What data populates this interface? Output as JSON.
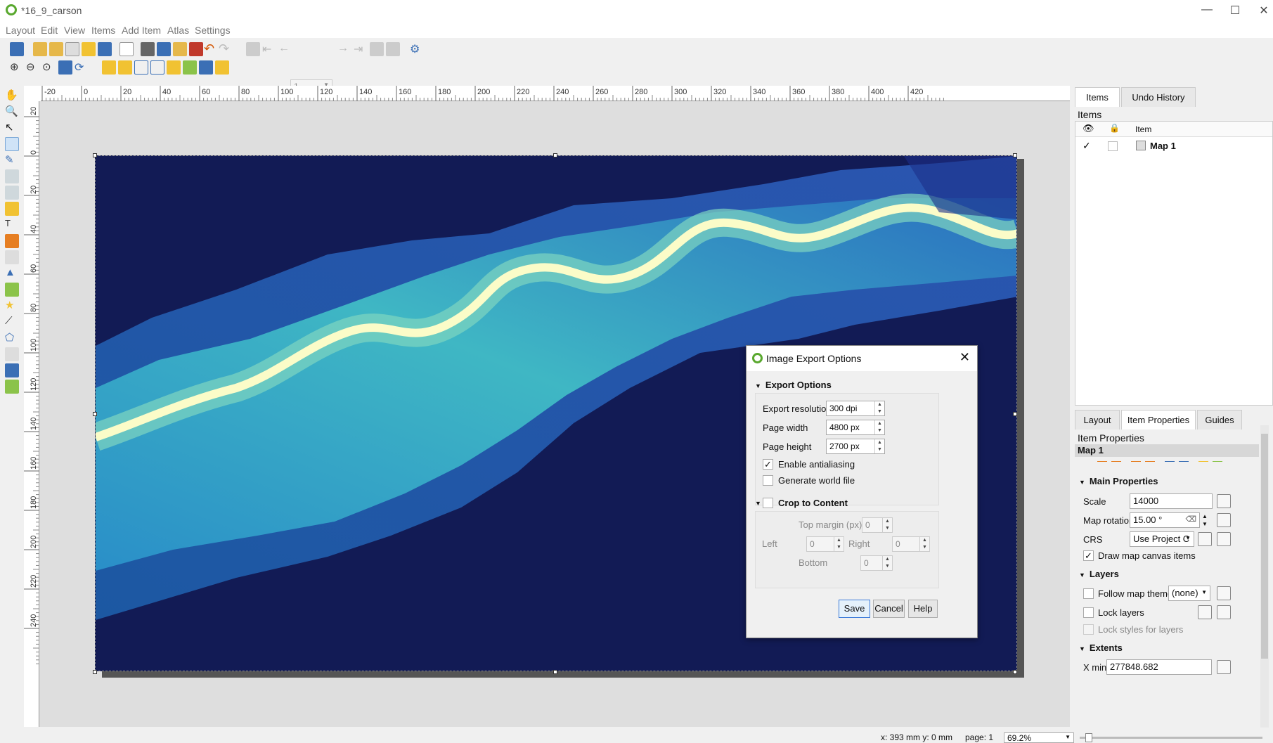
{
  "window": {
    "title": "*16_9_carson",
    "minimize": "—",
    "maximize": "☐",
    "close": "✕"
  },
  "menu": [
    "Layout",
    "Edit",
    "View",
    "Items",
    "Add Item",
    "Atlas",
    "Settings"
  ],
  "toolbar": {
    "atlas_page": "1"
  },
  "ruler": {
    "h_labels": [
      "-20",
      "0",
      "20",
      "40",
      "60",
      "80",
      "100",
      "120",
      "140",
      "160",
      "180",
      "200",
      "220",
      "240",
      "260",
      "280",
      "300",
      "320",
      "340",
      "360",
      "380",
      "400",
      "420"
    ],
    "v_labels": [
      "20",
      "0",
      "20",
      "40",
      "60",
      "80",
      "100",
      "120",
      "140",
      "160",
      "180",
      "200",
      "220",
      "240"
    ]
  },
  "dialog": {
    "title": "Image Export Options",
    "export_section": "Export Options",
    "resolution_label": "Export resolution",
    "resolution_value": "300 dpi",
    "width_label": "Page width",
    "width_value": "4800 px",
    "height_label": "Page height",
    "height_value": "2700 px",
    "antialias_label": "Enable antialiasing",
    "antialias_checked": "✓",
    "worldfile_label": "Generate world file",
    "crop_label": "Crop to Content",
    "top_margin_label": "Top margin (px)",
    "top_margin_value": "0",
    "left_label": "Left",
    "left_value": "0",
    "right_label": "Right",
    "right_value": "0",
    "bottom_label": "Bottom",
    "bottom_value": "0",
    "save": "Save",
    "cancel": "Cancel",
    "help": "Help"
  },
  "items_panel": {
    "tabs": [
      "Items",
      "Undo History"
    ],
    "title": "Items",
    "column_item": "Item",
    "rows": [
      {
        "checked": "✓",
        "name": "Map 1"
      }
    ]
  },
  "props_panel": {
    "tabs": [
      "Layout",
      "Item Properties",
      "Guides"
    ],
    "title": "Item Properties",
    "item_name": "Map 1",
    "main_section": "Main Properties",
    "scale_label": "Scale",
    "scale_value": "14000",
    "rotation_label": "Map rotation",
    "rotation_value": "15.00 °",
    "crs_label": "CRS",
    "crs_value": "Use Project C",
    "draw_canvas_label": "Draw map canvas items",
    "draw_canvas_checked": "✓",
    "layers_section": "Layers",
    "follow_theme_label": "Follow map theme",
    "follow_theme_value": "(none)",
    "lock_layers_label": "Lock layers",
    "lock_styles_label": "Lock styles for layers",
    "extents_section": "Extents",
    "xmin_label": "X min",
    "xmin_value": "277848.682"
  },
  "status": {
    "coords": "x: 393 mm y: 0 mm",
    "page": "page: 1",
    "zoom": "69.2%"
  },
  "colors": {
    "map_bg": "#121b55",
    "river": "#fbfcc8",
    "accent": "#3d7bd9"
  }
}
